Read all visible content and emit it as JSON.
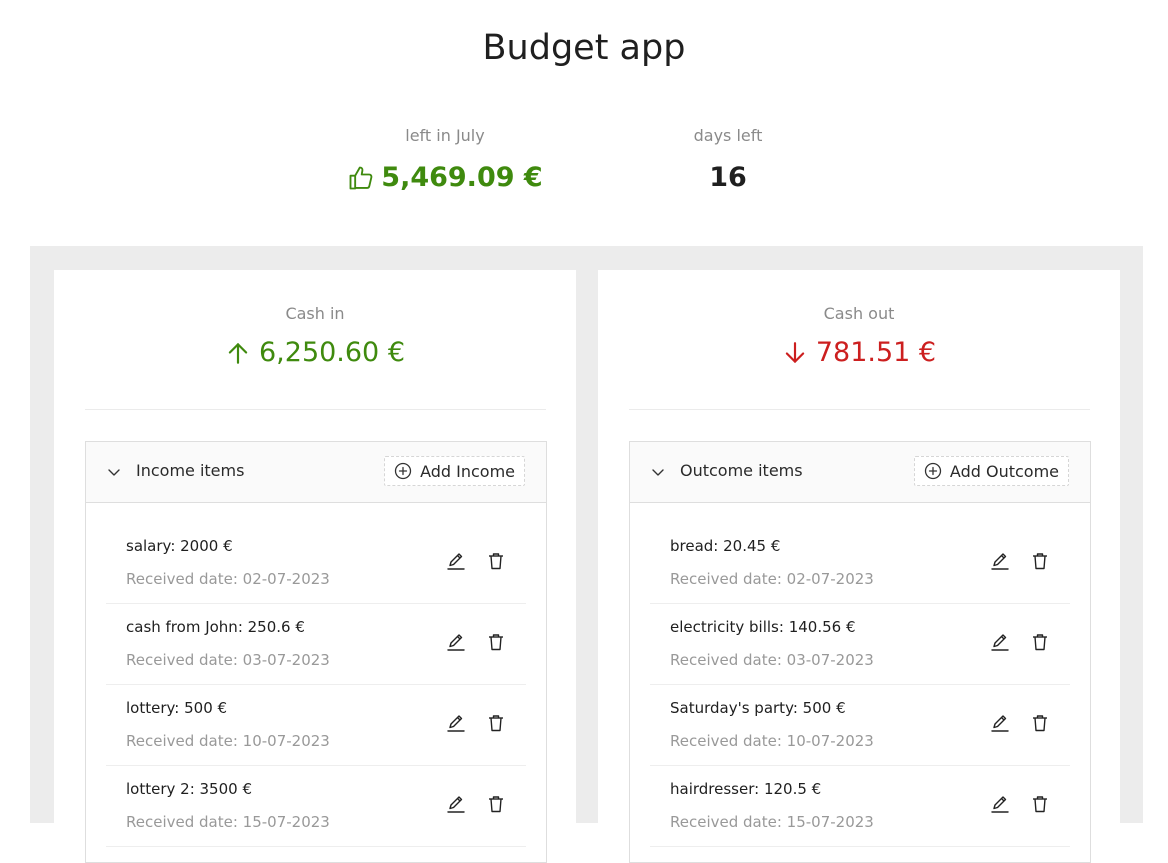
{
  "app": {
    "title": "Budget app"
  },
  "summary": {
    "left_label": "left in July",
    "left_value": "5,469.09 €",
    "days_label": "days left",
    "days_value": "16"
  },
  "cash_in": {
    "label": "Cash in",
    "amount": "6,250.60 €",
    "items_title": "Income items",
    "add_label": "Add Income",
    "items": [
      {
        "title": "salary: 2000 €",
        "date": "Received date: 02-07-2023"
      },
      {
        "title": "cash from John: 250.6 €",
        "date": "Received date: 03-07-2023"
      },
      {
        "title": "lottery: 500 €",
        "date": "Received date: 10-07-2023"
      },
      {
        "title": "lottery 2: 3500 €",
        "date": "Received date: 15-07-2023"
      }
    ]
  },
  "cash_out": {
    "label": "Cash out",
    "amount": "781.51 €",
    "items_title": "Outcome items",
    "add_label": "Add Outcome",
    "items": [
      {
        "title": "bread: 20.45 €",
        "date": "Received date: 02-07-2023"
      },
      {
        "title": "electricity bills: 140.56 €",
        "date": "Received date: 03-07-2023"
      },
      {
        "title": "Saturday's party: 500 €",
        "date": "Received date: 10-07-2023"
      },
      {
        "title": "hairdresser: 120.5 €",
        "date": "Received date: 15-07-2023"
      }
    ]
  },
  "colors": {
    "positive": "#3f8a0e",
    "negative": "#cc1f1f",
    "muted": "#8a8a8a",
    "board": "#ececec"
  },
  "icons": {
    "left_indicator": "thumbs-up-icon",
    "in_indicator": "arrow-up-icon",
    "out_indicator": "arrow-down-icon",
    "edit": "pencil-icon",
    "delete": "trash-icon",
    "add": "plus-circle-icon",
    "collapse": "chevron-down-icon"
  }
}
